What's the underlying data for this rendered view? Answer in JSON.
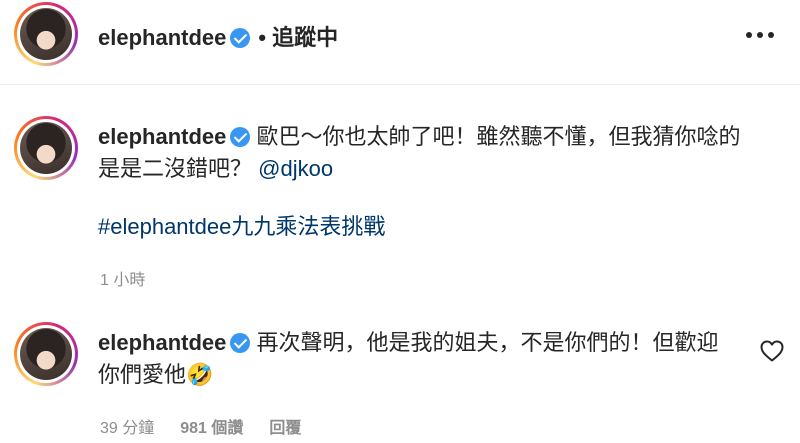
{
  "header": {
    "username": "elephantdee",
    "separator": "•",
    "follow_status": "追蹤中"
  },
  "caption": {
    "username": "elephantdee",
    "text": "歐巴～你也太帥了吧！雖然聽不懂，但我猜你唸的是是二沒錯吧？",
    "mention": "@djkoo",
    "hashtag": "#elephantdee九九乘法表挑戰",
    "time": "1 小時"
  },
  "reply": {
    "username": "elephantdee",
    "text": "再次聲明，他是我的姐夫，不是你們的！但歡迎你們愛他🤣",
    "time": "39 分鐘",
    "likes": "981 個讚",
    "reply_label": "回覆"
  }
}
